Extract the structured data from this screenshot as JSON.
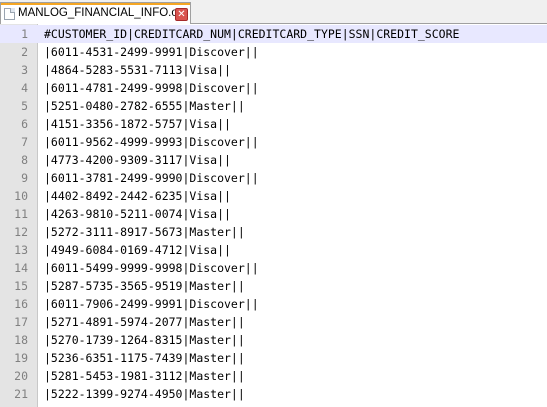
{
  "tab": {
    "title": "MANLOG_FINANCIAL_INFO.out",
    "close_symbol": "✕"
  },
  "editor": {
    "lines": [
      {
        "num": "1",
        "text": "#CUSTOMER_ID|CREDITCARD_NUM|CREDITCARD_TYPE|SSN|CREDIT_SCORE"
      },
      {
        "num": "2",
        "text": "|6011-4531-2499-9991|Discover||"
      },
      {
        "num": "3",
        "text": "|4864-5283-5531-7113|Visa||"
      },
      {
        "num": "4",
        "text": "|6011-4781-2499-9998|Discover||"
      },
      {
        "num": "5",
        "text": "|5251-0480-2782-6555|Master||"
      },
      {
        "num": "6",
        "text": "|4151-3356-1872-5757|Visa||"
      },
      {
        "num": "7",
        "text": "|6011-9562-4999-9993|Discover||"
      },
      {
        "num": "8",
        "text": "|4773-4200-9309-3117|Visa||"
      },
      {
        "num": "9",
        "text": "|6011-3781-2499-9990|Discover||"
      },
      {
        "num": "10",
        "text": "|4402-8492-2442-6235|Visa||"
      },
      {
        "num": "11",
        "text": "|4263-9810-5211-0074|Visa||"
      },
      {
        "num": "12",
        "text": "|5272-3111-8917-5673|Master||"
      },
      {
        "num": "13",
        "text": "|4949-6084-0169-4712|Visa||"
      },
      {
        "num": "14",
        "text": "|6011-5499-9999-9998|Discover||"
      },
      {
        "num": "15",
        "text": "|5287-5735-3565-9519|Master||"
      },
      {
        "num": "16",
        "text": "|6011-7906-2499-9991|Discover||"
      },
      {
        "num": "17",
        "text": "|5271-4891-5974-2077|Master||"
      },
      {
        "num": "18",
        "text": "|5270-1739-1264-8315|Master||"
      },
      {
        "num": "19",
        "text": "|5236-6351-1175-7439|Master||"
      },
      {
        "num": "20",
        "text": "|5281-5453-1981-3112|Master||"
      },
      {
        "num": "21",
        "text": "|5222-1399-9274-4950|Master||"
      }
    ]
  }
}
